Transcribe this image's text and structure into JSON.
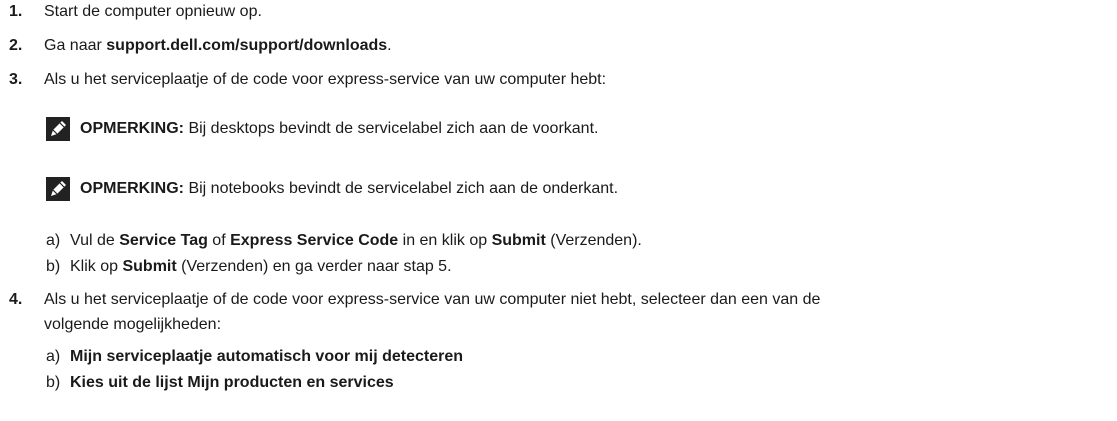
{
  "steps": [
    {
      "num": "1.",
      "text": "Start de computer opnieuw op."
    },
    {
      "num": "2.",
      "pre": "Ga naar ",
      "link": "support.dell.com/support/downloads",
      "post": "."
    },
    {
      "num": "3.",
      "text": "Als u het serviceplaatje of de code voor express-service van uw computer hebt:"
    },
    {
      "num": "4.",
      "line1": "Als u het serviceplaatje of de code voor express-service van uw computer niet hebt, selecteer dan een van de",
      "line2": "volgende mogelijkheden:"
    }
  ],
  "notes": [
    {
      "label": "OPMERKING:",
      "text": " Bij desktops bevindt de servicelabel zich aan de voorkant."
    },
    {
      "label": "OPMERKING:",
      "text": " Bij notebooks bevindt de servicelabel zich aan de onderkant."
    }
  ],
  "step3_sub": [
    {
      "marker": "a)",
      "t1": "Vul de ",
      "b1": "Service Tag",
      "t2": " of ",
      "b2": "Express Service Code",
      "t3": " in en klik op ",
      "b3": "Submit",
      "t4": " (Verzenden)."
    },
    {
      "marker": "b)",
      "t1": "Klik op ",
      "b1": "Submit",
      "t2": " (Verzenden) en ga verder naar stap 5."
    }
  ],
  "step4_sub": [
    {
      "marker": "a)",
      "text": "Mijn serviceplaatje automatisch voor mij detecteren"
    },
    {
      "marker": "b)",
      "text": "Kies uit de lijst Mijn producten en services"
    }
  ]
}
